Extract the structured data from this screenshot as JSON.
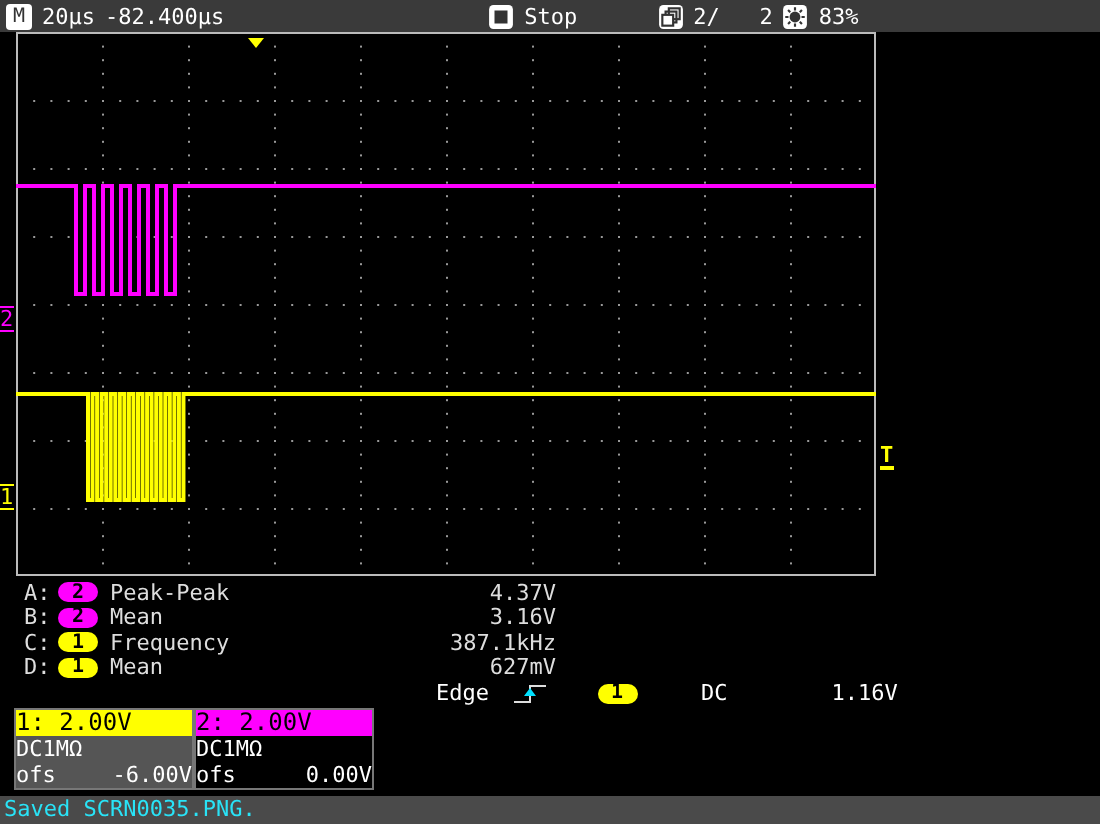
{
  "top_bar": {
    "mode": "M",
    "timebase": "20µs",
    "position": "-82.400µs",
    "run_state": "Stop",
    "acquisition": "2/   2",
    "brightness": "83%"
  },
  "graticule": {
    "channel_markers": [
      {
        "label": "2",
        "color": "#ff00ff"
      },
      {
        "label": "1",
        "color": "#ffff00"
      }
    ],
    "trigger_marker": "T"
  },
  "measurements": [
    {
      "slot": "A:",
      "channel": "2",
      "color": "#ff00ff",
      "name": "Peak-Peak",
      "value": "4.37V"
    },
    {
      "slot": "B:",
      "channel": "2",
      "color": "#ff00ff",
      "name": "Mean",
      "value": "3.16V"
    },
    {
      "slot": "C:",
      "channel": "1",
      "color": "#ffff00",
      "name": "Frequency",
      "value": "387.1kHz"
    },
    {
      "slot": "D:",
      "channel": "1",
      "color": "#ffff00",
      "name": "Mean",
      "value": "627mV"
    }
  ],
  "trigger": {
    "type": "Edge",
    "channel": "1",
    "coupling": "DC",
    "level": "1.16V"
  },
  "channels": [
    {
      "header": "1: 2.00V",
      "color": "#ffff00",
      "coupling": "DC1MΩ",
      "offset_label": "ofs",
      "offset": "-6.00V",
      "selected": true
    },
    {
      "header": "2: 2.00V",
      "color": "#ff00ff",
      "coupling": "DC1MΩ",
      "offset_label": "ofs",
      "offset": "0.00V",
      "selected": false
    }
  ],
  "status_bar": "Saved SCRN0035.PNG."
}
